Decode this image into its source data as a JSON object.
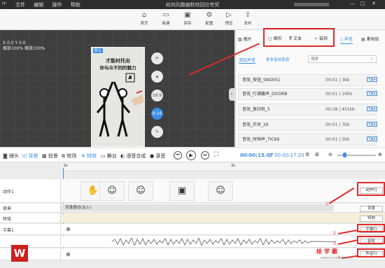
{
  "app": {
    "logo": "H¹",
    "title": "如何风趣幽默地回应夸奖",
    "menu": [
      "文件",
      "编辑",
      "操作",
      "帮助"
    ]
  },
  "toolbar": {
    "buttons": [
      "首页",
      "新建",
      "保存",
      "配置",
      "预览",
      "发布"
    ]
  },
  "canvas": {
    "coord": "X 0.0 Y 0.0",
    "zoom_text": "缩放100% 缩放100%",
    "tag": "默认",
    "headline1": "才能衬托出",
    "headline2": "你与众不同的魅力",
    "ratio_label": "16:9",
    "rotate_label": "9:16"
  },
  "panel": {
    "tabs": [
      "图片",
      "图形",
      "文本",
      "装饰",
      "声音",
      "素材库"
    ],
    "subtabs": {
      "add": "添加声音",
      "more": "更多音效资源"
    },
    "search_placeholder": "搜索",
    "sounds": [
      {
        "name": "音效_按钮_SND051",
        "meta": "00:01 | 3kb"
      },
      {
        "name": "音效_叮满腹声_DOORB",
        "meta": "00:01 | 10kb"
      },
      {
        "name": "音效_复印机_5",
        "meta": "00:28 | 451kb"
      },
      {
        "name": "音效_开关_26",
        "meta": "00:01 | 7kb"
      },
      {
        "name": "音效_时钟声_TICK6",
        "meta": "00:01 | 5kb"
      }
    ]
  },
  "timeline_bar": {
    "items": [
      "镜头",
      "背景",
      "前景",
      "转场",
      "特效",
      "舞台",
      "语音合成",
      "录音"
    ],
    "current_time": "00:00:15.07",
    "total_time": "00:00:17.20"
  },
  "ruler": {
    "marks": [
      "0s",
      "3s"
    ]
  },
  "tracks": [
    {
      "label": "动作1",
      "button": "动作行"
    },
    {
      "label": "背景",
      "button": "背景",
      "bar": "背景缓动(淡入)"
    },
    {
      "label": "特效",
      "button": "特效"
    },
    {
      "label": "字幕1",
      "button": "字幕行"
    },
    {
      "label": "",
      "button": "音轨"
    },
    {
      "label": "",
      "button": "声音行"
    }
  ],
  "annotations": {
    "n1": "1",
    "n2": "2",
    "n3": "3",
    "n4": "4"
  },
  "watermark": "绘学霸",
  "watermark_site": "www.huixueba.net",
  "accent": "#e02a2a",
  "brand": "#3a8ee6"
}
